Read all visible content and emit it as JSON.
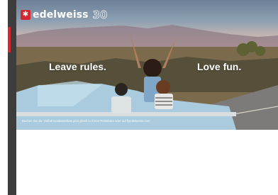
{
  "banner": {
    "brand": {
      "name": "edelweiss",
      "anniversary": "30",
      "logo": "edelweiss-flower-icon"
    },
    "headline_left": "Leave rules.",
    "headline_right": "Love fun.",
    "disclaimer": "Buchen Sie die Vielfalt Nordamerikas jetzt gleich in Ihrem Reisebüro oder auf flyedelweiss.com"
  },
  "colors": {
    "brand_red": "#d6262f",
    "sidebar": "#3d3d3d",
    "car": "#a9cbdd"
  }
}
